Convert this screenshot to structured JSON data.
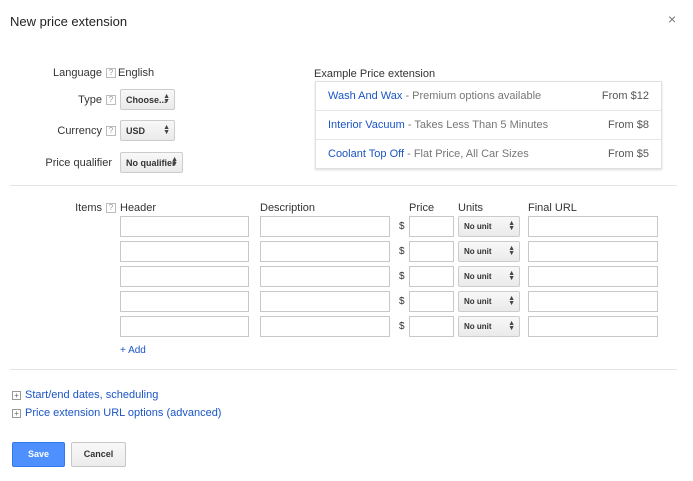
{
  "dialog": {
    "title": "New price extension",
    "close_label": "×"
  },
  "form": {
    "help_glyph": "?",
    "language": {
      "label": "Language",
      "value": "English"
    },
    "type": {
      "label": "Type",
      "value": "Choose..."
    },
    "currency": {
      "label": "Currency",
      "value": "USD"
    },
    "price_qualifier": {
      "label": "Price qualifier",
      "value": "No qualifier"
    }
  },
  "example": {
    "title": "Example Price extension",
    "rows": [
      {
        "header": "Wash And Wax",
        "description": " - Premium options available",
        "price": "From $12"
      },
      {
        "header": "Interior Vacuum",
        "description": " - Takes Less Than 5 Minutes",
        "price": "From $8"
      },
      {
        "header": "Coolant Top Off",
        "description": " - Flat Price, All Car Sizes",
        "price": "From $5"
      }
    ]
  },
  "items": {
    "label": "Items",
    "columns": {
      "header": "Header",
      "description": "Description",
      "price": "Price",
      "units": "Units",
      "final_url": "Final URL"
    },
    "currency_symbol": "$",
    "unit_default": "No unit",
    "rows": [
      {
        "header": "",
        "description": "",
        "price": "",
        "unit": "No unit",
        "final_url": ""
      },
      {
        "header": "",
        "description": "",
        "price": "",
        "unit": "No unit",
        "final_url": ""
      },
      {
        "header": "",
        "description": "",
        "price": "",
        "unit": "No unit",
        "final_url": ""
      },
      {
        "header": "",
        "description": "",
        "price": "",
        "unit": "No unit",
        "final_url": ""
      },
      {
        "header": "",
        "description": "",
        "price": "",
        "unit": "No unit",
        "final_url": ""
      }
    ],
    "add_label": "+ Add"
  },
  "advanced": {
    "expander_glyph": "+",
    "scheduling_label": "Start/end dates, scheduling",
    "url_options_label": "Price extension URL options (advanced)"
  },
  "actions": {
    "save_label": "Save",
    "cancel_label": "Cancel"
  },
  "colors": {
    "link": "#1a55c4",
    "primary_button": "#4d90fe"
  }
}
